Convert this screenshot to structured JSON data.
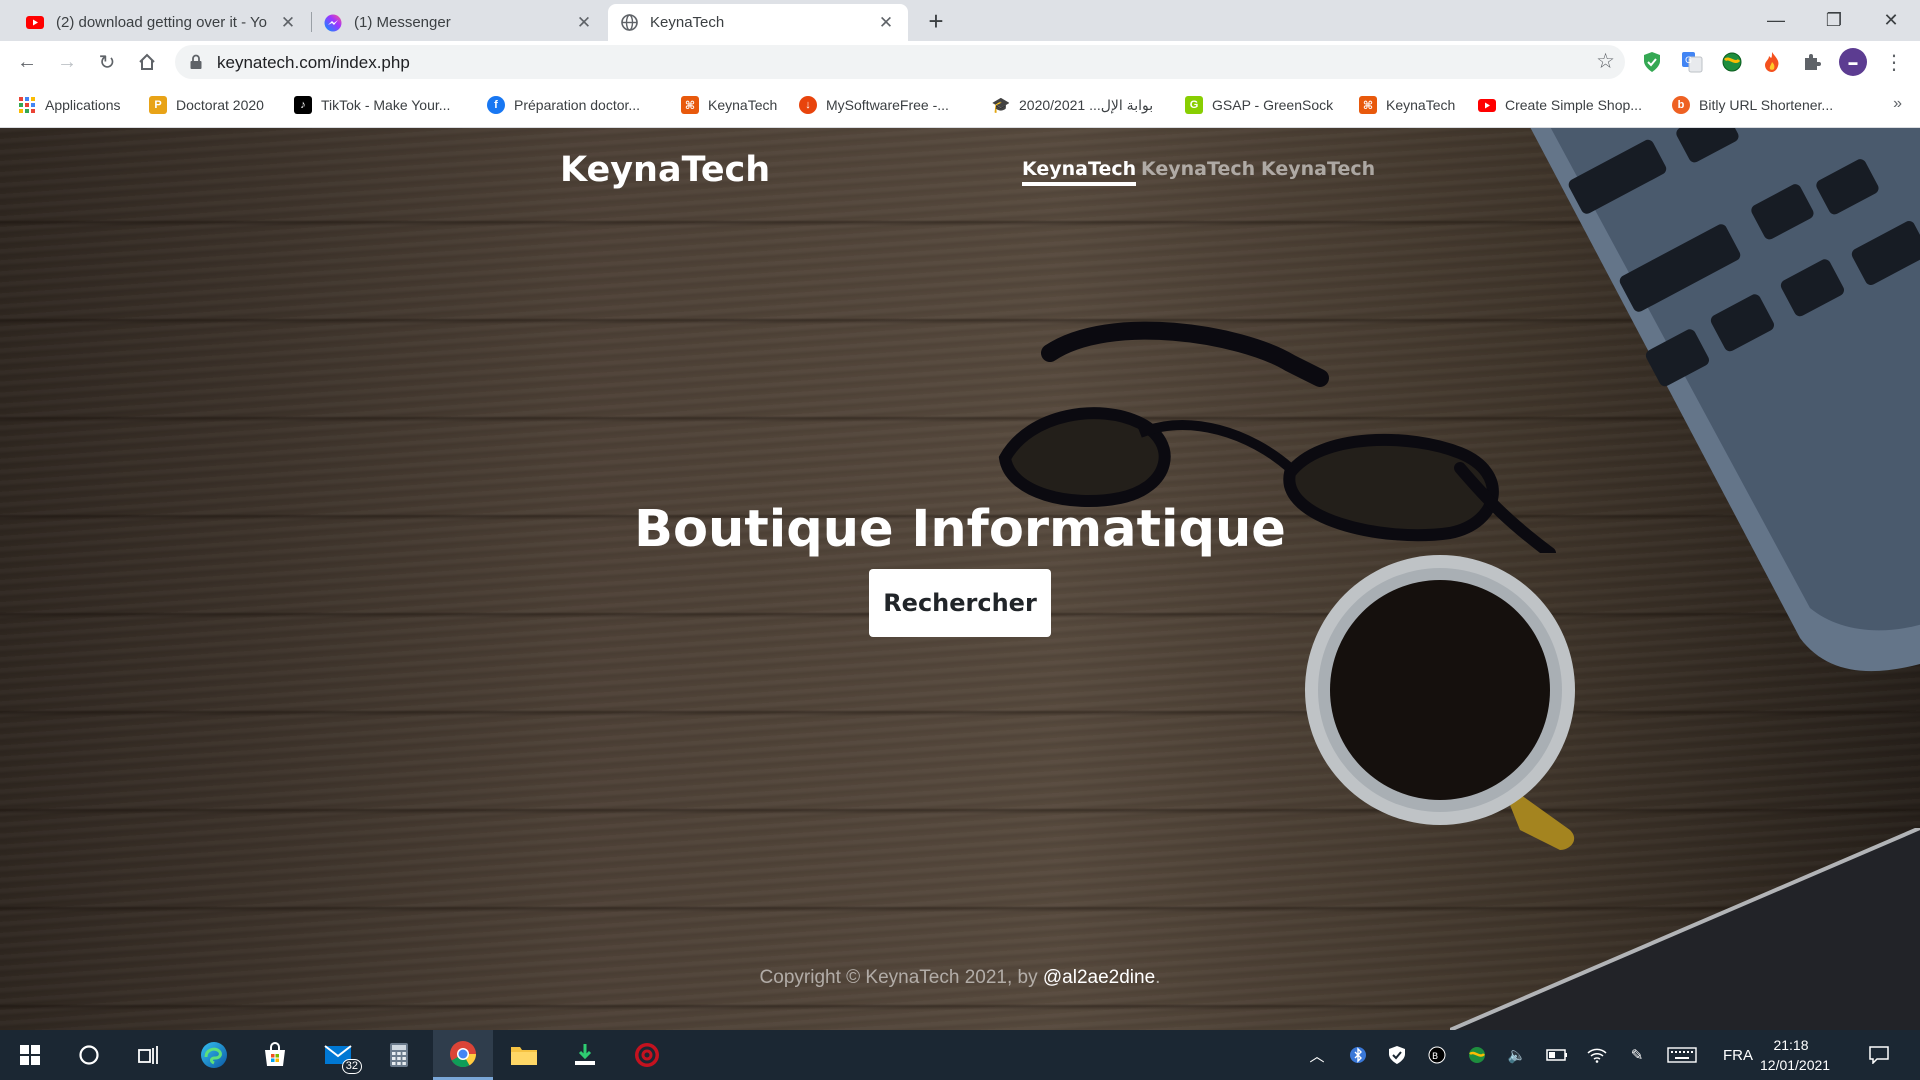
{
  "tabs": [
    {
      "title": "(2) download getting over it - Yo",
      "icon": "youtube-icon"
    },
    {
      "title": "(1) Messenger",
      "icon": "messenger-icon"
    },
    {
      "title": "KeynaTech",
      "icon": "globe-icon"
    }
  ],
  "toolbar": {
    "url": "keynatech.com/index.php"
  },
  "bookmarks": [
    {
      "label": "Applications",
      "icon": "apps-grid-icon"
    },
    {
      "label": "Doctorat 2020",
      "icon": "p-icon"
    },
    {
      "label": "TikTok - Make Your...",
      "icon": "tiktok-icon"
    },
    {
      "label": "Préparation doctor...",
      "icon": "facebook-icon"
    },
    {
      "label": "KeynaTech",
      "icon": "keynatech-icon"
    },
    {
      "label": "MySoftwareFree -...",
      "icon": "download-icon"
    },
    {
      "label": "بوابة الإل... 2020/2021",
      "icon": "graduation-cap-icon"
    },
    {
      "label": "GSAP - GreenSock",
      "icon": "greensock-icon"
    },
    {
      "label": "KeynaTech",
      "icon": "keynatech-icon"
    },
    {
      "label": "Create Simple Shop...",
      "icon": "youtube-icon"
    },
    {
      "label": "Bitly URL Shortener...",
      "icon": "bitly-icon"
    }
  ],
  "site": {
    "brand": "KeynaTech",
    "nav": [
      "KeynaTech",
      "KeynaTech",
      "KeynaTech"
    ],
    "hero_title": "Boutique Informatique",
    "cta_label": "Rechercher",
    "footer_text": "Copyright © KeynaTech 2021, by ",
    "footer_handle": "@al2ae2dine",
    "footer_end": "."
  },
  "taskbar": {
    "mail_badge": "32",
    "language": "FRA",
    "time": "21:18",
    "date": "12/01/2021"
  },
  "colors": {
    "tabstrip": "#dee1e6",
    "taskbar": "#1b2733",
    "youtube_red": "#ff0000",
    "keynatech_orange": "#e8590c"
  }
}
